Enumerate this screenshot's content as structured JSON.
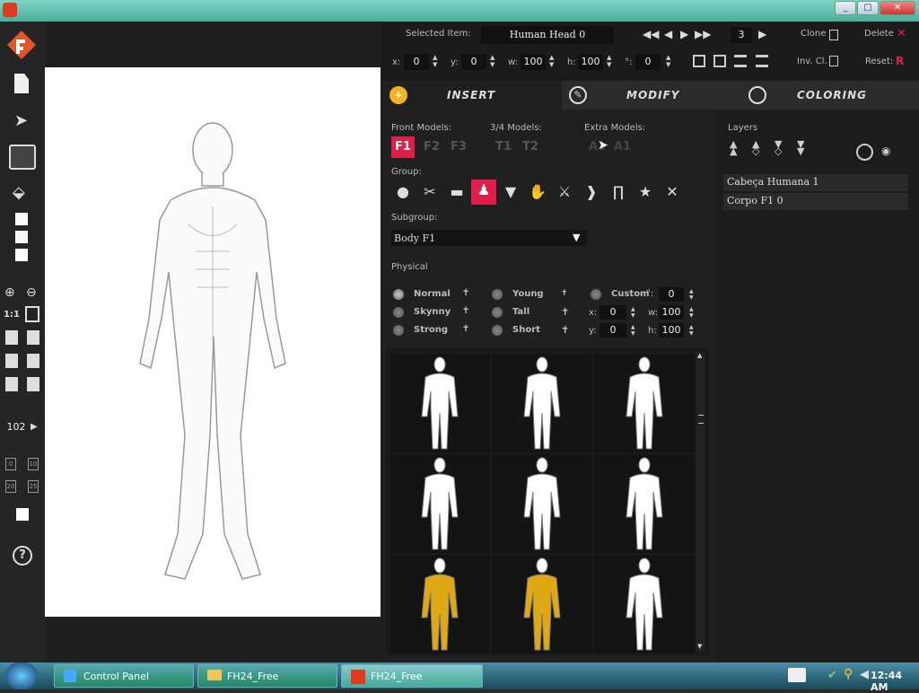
{
  "window": {
    "controls": [
      "_",
      "▢",
      "✕"
    ]
  },
  "toolbar": {
    "selected_item_label": "Selected Item:",
    "selected_item_value": "Human Head 0",
    "frame_value": "3",
    "clone_label": "Clone",
    "delete_label": "Delete",
    "inv_cl_label": "Inv. Cl.",
    "reset_label": "Reset:",
    "x_label": "x:",
    "x_value": "0",
    "y_label": "y:",
    "y_value": "0",
    "w_label": "w:",
    "w_value": "100",
    "h_label": "h:",
    "h_value": "100",
    "rot_label": "°:",
    "rot_value": "0"
  },
  "tabs": [
    {
      "label": "INSERT"
    },
    {
      "label": "MODIFY"
    },
    {
      "label": "COLORING"
    }
  ],
  "models": {
    "front_label": "Front Models:",
    "front": [
      "F1",
      "F2",
      "F3"
    ],
    "three_quarter_label": "3/4 Models:",
    "three_quarter": [
      "T1",
      "T2"
    ],
    "extra_label": "Extra Models:",
    "extra": [
      "A1",
      "A1"
    ]
  },
  "group_label": "Group:",
  "subgroup_label": "Subgroup:",
  "subgroup_value": "Body F1",
  "physical": {
    "label": "Physical",
    "options": [
      "Normal",
      "Skynny",
      "Strong",
      "Young",
      "Tall",
      "Short",
      "Custom"
    ],
    "custom_rot_label": "°:",
    "custom_rot_value": "0",
    "x_label": "x:",
    "x_value": "0",
    "y_label": "y:",
    "y_value": "0",
    "w_label": "w:",
    "w_value": "100",
    "h_label": "h:",
    "h_value": "100"
  },
  "left_toolbar": {
    "zoom_value": "102",
    "one_to_one": "1:1",
    "grid_values": [
      "0",
      "10",
      "20",
      "25"
    ]
  },
  "layers": {
    "label": "Layers",
    "items": [
      "Cabeça Humana 1",
      "Corpo F1 0"
    ]
  },
  "taskbar": {
    "items": [
      "Control Panel",
      "FH24_Free",
      "FH24_Free"
    ],
    "clock": "12:44 AM"
  },
  "colors": {
    "accent": "#e01e4a",
    "gold": "#e0a814",
    "insert_icon": "#f0b323"
  },
  "thumbnails": [
    "normal",
    "skinny",
    "strong",
    "young",
    "tall",
    "short",
    "gold-armor-a",
    "gold-armor-b",
    "muscular"
  ]
}
